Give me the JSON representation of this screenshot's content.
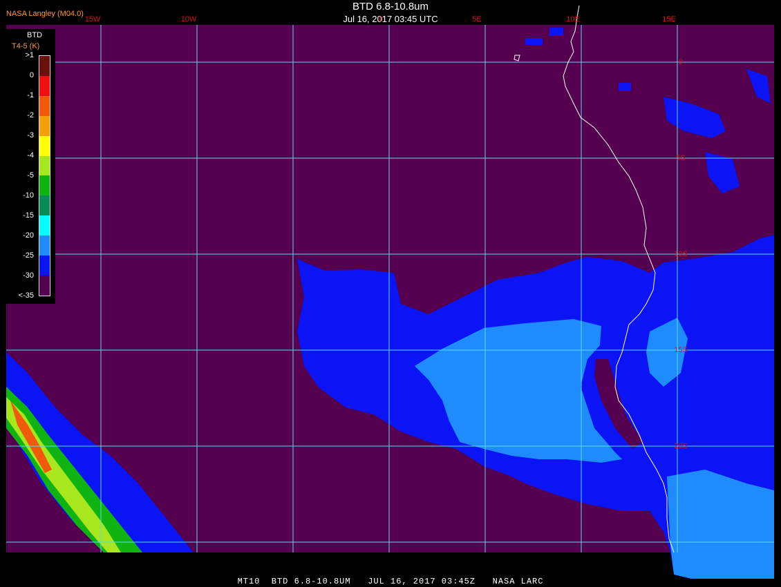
{
  "header": {
    "credit": "NASA Langley (M04.0)",
    "title": "BTD 6.8-10.8um",
    "datetime": "Jul 16, 2017 03:45 UTC"
  },
  "footer": {
    "text": "MT10  BTD 6.8-10.8UM   JUL 16, 2017 03:45Z   NASA LARC"
  },
  "grid": {
    "longitudes": [
      {
        "label": "15W",
        "lon": -15
      },
      {
        "label": "10W",
        "lon": -10
      },
      {
        "label": "",
        "lon": -5
      },
      {
        "label": "0",
        "lon": 0
      },
      {
        "label": "5E",
        "lon": 5
      },
      {
        "label": "10E",
        "lon": 10
      },
      {
        "label": "15E",
        "lon": 15
      }
    ],
    "latitudes": [
      {
        "label": "0",
        "lat": 0
      },
      {
        "label": "5S",
        "lat": -5
      },
      {
        "label": "10S",
        "lat": -10
      },
      {
        "label": "15S",
        "lat": -15
      },
      {
        "label": "20S",
        "lat": -20
      },
      {
        "label": "",
        "lat": -25
      }
    ]
  },
  "legend": {
    "title": "BTD",
    "subtitle": "T4-5 (K)",
    "items": [
      {
        "label": ">1",
        "color": "#6b0f0f"
      },
      {
        "label": "0",
        "color": "#f01010"
      },
      {
        "label": "-1",
        "color": "#f05a0a"
      },
      {
        "label": "-2",
        "color": "#f5a00a"
      },
      {
        "label": "-3",
        "color": "#ffff00"
      },
      {
        "label": "-4",
        "color": "#a8e61e"
      },
      {
        "label": "-5",
        "color": "#10b410"
      },
      {
        "label": "-10",
        "color": "#0a8c5a"
      },
      {
        "label": "-15",
        "color": "#00ffff"
      },
      {
        "label": "-20",
        "color": "#1e8cff"
      },
      {
        "label": "-25",
        "color": "#0a14f5"
      },
      {
        "label": "-30",
        "color": "#55004f"
      },
      {
        "label": "<-35",
        "color": ""
      }
    ]
  },
  "colors": {
    "background": "#55004f",
    "grid": "#5adcf0",
    "coast": "#ffffff",
    "lightBlue": "#1e8cff",
    "blue": "#0a14f5"
  }
}
